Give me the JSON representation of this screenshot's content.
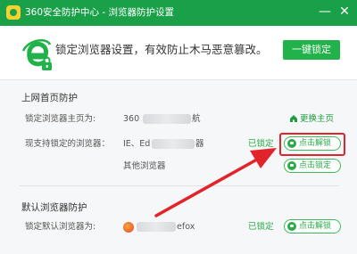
{
  "window": {
    "title": "360安全防护中心 - 浏览器防护设置",
    "minimize_glyph": "—",
    "close_glyph": "✕"
  },
  "header": {
    "slogan": "锁定浏览器设置，有效防止木马恶意篡改。",
    "lock_all_label": "一键锁定"
  },
  "homepage_section": {
    "title": "上网首页防护",
    "homepage_label": "锁定浏览器主页为:",
    "homepage_value_start": "360",
    "homepage_value_end": "航",
    "change_homepage_label": "更换主页",
    "supported_label": "现支持锁定的浏览器：",
    "browser_list_start": "IE、Ed",
    "browser_list_end": "器",
    "browser_locked_status": "已锁定",
    "unlock_label": "点击解锁",
    "other_browsers_label": "其他浏览器",
    "lock_label": "点击锁定"
  },
  "default_browser_section": {
    "title": "默认浏览器防护",
    "default_label": "锁定默认浏览器为:",
    "default_value_end": "efox",
    "locked_status": "已锁定",
    "unlock_label": "点击解锁"
  },
  "colors": {
    "brand_green": "#1aa049",
    "button_green": "#21b24a",
    "annotation_red": "#e3232a"
  },
  "icons": {
    "app_logo": "360-logo-icon",
    "browser_shield": "ie-lock-icon",
    "home": "home-icon",
    "lock": "lock-icon",
    "firefox": "firefox-icon"
  }
}
